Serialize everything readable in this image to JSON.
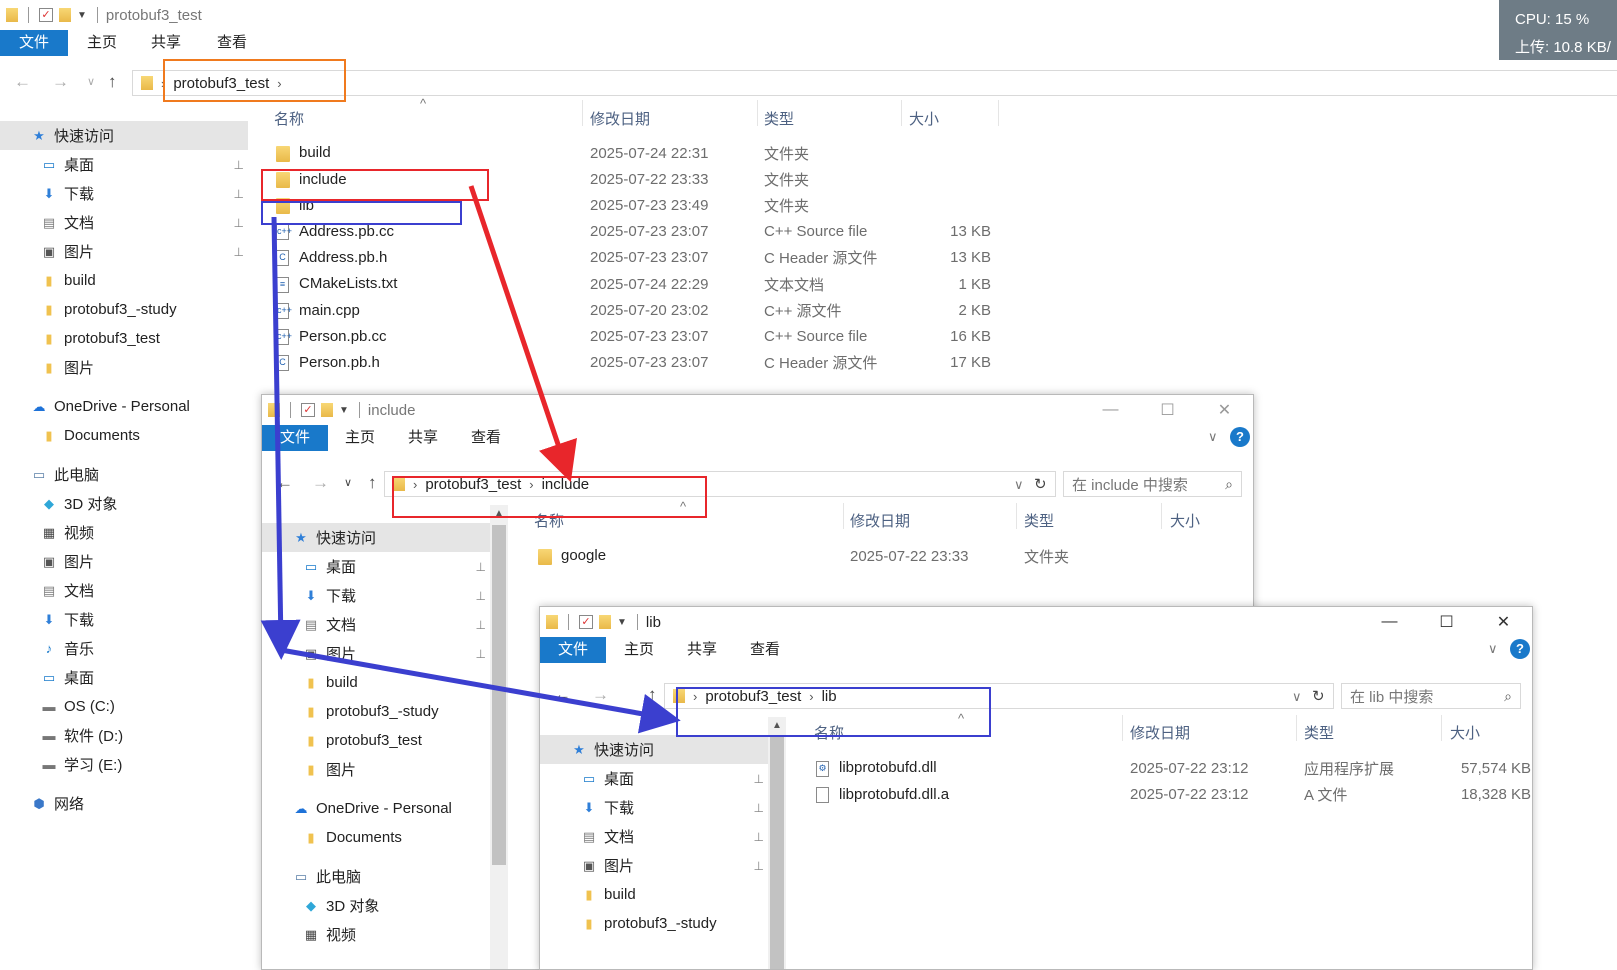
{
  "main": {
    "title": "protobuf3_test",
    "tabs": [
      "文件",
      "主页",
      "共享",
      "查看"
    ],
    "breadcrumb": [
      "protobuf3_test"
    ],
    "columns": [
      "名称",
      "修改日期",
      "类型",
      "大小"
    ],
    "sidebar": [
      {
        "label": "快速访问",
        "icon": "star-icon",
        "active": true
      },
      {
        "label": "桌面",
        "icon": "desktop-icon",
        "pinned": true
      },
      {
        "label": "下载",
        "icon": "download-icon",
        "pinned": true
      },
      {
        "label": "文档",
        "icon": "document-icon",
        "pinned": true
      },
      {
        "label": "图片",
        "icon": "picture-icon",
        "pinned": true
      },
      {
        "label": "build",
        "icon": "folder-icon"
      },
      {
        "label": "protobuf3_-study",
        "icon": "folder-icon"
      },
      {
        "label": "protobuf3_test",
        "icon": "folder-icon"
      },
      {
        "label": "图片",
        "icon": "folder-icon"
      },
      {
        "label": "OneDrive - Personal",
        "icon": "cloud-icon"
      },
      {
        "label": "Documents",
        "icon": "folder-icon"
      },
      {
        "label": "此电脑",
        "icon": "computer-icon"
      },
      {
        "label": "3D 对象",
        "icon": "cube-icon"
      },
      {
        "label": "视频",
        "icon": "video-icon"
      },
      {
        "label": "图片",
        "icon": "picture-icon"
      },
      {
        "label": "文档",
        "icon": "document-icon"
      },
      {
        "label": "下载",
        "icon": "download-icon"
      },
      {
        "label": "音乐",
        "icon": "music-icon"
      },
      {
        "label": "桌面",
        "icon": "desktop-icon"
      },
      {
        "label": "OS (C:)",
        "icon": "drive-icon"
      },
      {
        "label": "软件 (D:)",
        "icon": "drive-icon"
      },
      {
        "label": "学习 (E:)",
        "icon": "drive-icon"
      },
      {
        "label": "网络",
        "icon": "network-icon"
      }
    ],
    "files": [
      {
        "name": "build",
        "date": "2025-07-24 22:31",
        "type": "文件夹",
        "size": "",
        "icon": "folder-icon"
      },
      {
        "name": "include",
        "date": "2025-07-22 23:33",
        "type": "文件夹",
        "size": "",
        "icon": "folder-icon"
      },
      {
        "name": "lib",
        "date": "2025-07-23 23:49",
        "type": "文件夹",
        "size": "",
        "icon": "folder-icon"
      },
      {
        "name": "Address.pb.cc",
        "date": "2025-07-23 23:07",
        "type": "C++ Source file",
        "size": "13 KB",
        "icon": "cpp-file-icon"
      },
      {
        "name": "Address.pb.h",
        "date": "2025-07-23 23:07",
        "type": "C Header 源文件",
        "size": "13 KB",
        "icon": "header-file-icon"
      },
      {
        "name": "CMakeLists.txt",
        "date": "2025-07-24 22:29",
        "type": "文本文档",
        "size": "1 KB",
        "icon": "text-file-icon"
      },
      {
        "name": "main.cpp",
        "date": "2025-07-20 23:02",
        "type": "C++ 源文件",
        "size": "2 KB",
        "icon": "cpp-file-icon"
      },
      {
        "name": "Person.pb.cc",
        "date": "2025-07-23 23:07",
        "type": "C++ Source file",
        "size": "16 KB",
        "icon": "cpp-file-icon"
      },
      {
        "name": "Person.pb.h",
        "date": "2025-07-23 23:07",
        "type": "C Header 源文件",
        "size": "17 KB",
        "icon": "header-file-icon"
      }
    ]
  },
  "include_win": {
    "title": "include",
    "tabs": [
      "文件",
      "主页",
      "共享",
      "查看"
    ],
    "breadcrumb": [
      "protobuf3_test",
      "include"
    ],
    "search_placeholder": "在 include 中搜索",
    "columns": [
      "名称",
      "修改日期",
      "类型",
      "大小"
    ],
    "sidebar": [
      {
        "label": "快速访问",
        "icon": "star-icon",
        "active": true
      },
      {
        "label": "桌面",
        "icon": "desktop-icon",
        "pinned": true
      },
      {
        "label": "下载",
        "icon": "download-icon",
        "pinned": true
      },
      {
        "label": "文档",
        "icon": "document-icon",
        "pinned": true
      },
      {
        "label": "图片",
        "icon": "picture-icon",
        "pinned": true
      },
      {
        "label": "build",
        "icon": "folder-icon"
      },
      {
        "label": "protobuf3_-study",
        "icon": "folder-icon"
      },
      {
        "label": "protobuf3_test",
        "icon": "folder-icon"
      },
      {
        "label": "图片",
        "icon": "folder-icon"
      },
      {
        "label": "OneDrive - Personal",
        "icon": "cloud-icon"
      },
      {
        "label": "Documents",
        "icon": "folder-icon"
      },
      {
        "label": "此电脑",
        "icon": "computer-icon"
      },
      {
        "label": "3D 对象",
        "icon": "cube-icon"
      },
      {
        "label": "视频",
        "icon": "video-icon"
      }
    ],
    "files": [
      {
        "name": "google",
        "date": "2025-07-22 23:33",
        "type": "文件夹",
        "size": "",
        "icon": "folder-icon"
      }
    ]
  },
  "lib_win": {
    "title": "lib",
    "tabs": [
      "文件",
      "主页",
      "共享",
      "查看"
    ],
    "breadcrumb": [
      "protobuf3_test",
      "lib"
    ],
    "search_placeholder": "在 lib 中搜索",
    "columns": [
      "名称",
      "修改日期",
      "类型",
      "大小"
    ],
    "sidebar": [
      {
        "label": "快速访问",
        "icon": "star-icon",
        "active": true
      },
      {
        "label": "桌面",
        "icon": "desktop-icon",
        "pinned": true
      },
      {
        "label": "下载",
        "icon": "download-icon",
        "pinned": true
      },
      {
        "label": "文档",
        "icon": "document-icon",
        "pinned": true
      },
      {
        "label": "图片",
        "icon": "picture-icon",
        "pinned": true
      },
      {
        "label": "build",
        "icon": "folder-icon"
      },
      {
        "label": "protobuf3_-study",
        "icon": "folder-icon"
      }
    ],
    "files": [
      {
        "name": "libprotobufd.dll",
        "date": "2025-07-22 23:12",
        "type": "应用程序扩展",
        "size": "57,574 KB",
        "icon": "dll-file-icon"
      },
      {
        "name": "libprotobufd.dll.a",
        "date": "2025-07-22 23:12",
        "type": "A 文件",
        "size": "18,328 KB",
        "icon": "generic-file-icon"
      }
    ]
  },
  "system": {
    "cpu": "CPU: 15 %",
    "upload": "上传: 10.8 KB/"
  },
  "colors": {
    "accent": "#1979ca",
    "annotation_red": "#e8262b",
    "annotation_blue": "#3b3fcf",
    "annotation_orange": "#f07a1e"
  }
}
